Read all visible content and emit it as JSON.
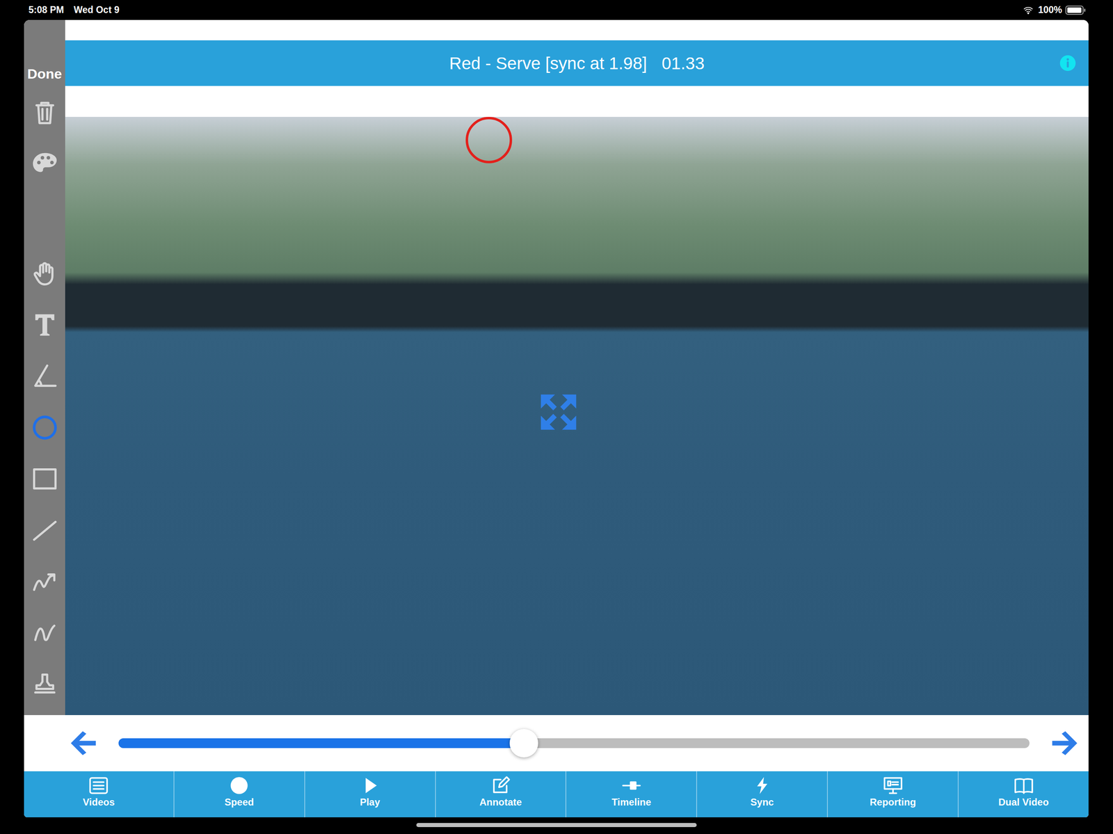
{
  "status_bar": {
    "time": "5:08 PM",
    "date": "Wed Oct 9",
    "battery": "100%",
    "battery_level": 1
  },
  "sidebar": {
    "done": "Done",
    "tools": [
      {
        "kind": "trash",
        "selected": false
      },
      {
        "kind": "palette",
        "selected": false
      },
      {
        "kind": "hand",
        "selected": false
      },
      {
        "kind": "text",
        "selected": false
      },
      {
        "kind": "angle",
        "selected": false
      },
      {
        "kind": "circle",
        "selected": true
      },
      {
        "kind": "rectangle",
        "selected": false
      },
      {
        "kind": "line",
        "selected": false
      },
      {
        "kind": "arrow",
        "selected": false
      },
      {
        "kind": "freehand",
        "selected": false
      },
      {
        "kind": "stamp",
        "selected": false
      }
    ]
  },
  "header": {
    "title": "Red - Serve [sync at 1.98]",
    "time": "01.33"
  },
  "scrubber": {
    "level": 0.445
  },
  "toolbar": [
    {
      "label": "Videos",
      "kind": "videos"
    },
    {
      "label": "Speed",
      "kind": "speed"
    },
    {
      "label": "Play",
      "kind": "play"
    },
    {
      "label": "Annotate",
      "kind": "annotate"
    },
    {
      "label": "Timeline",
      "kind": "timeline"
    },
    {
      "label": "Sync",
      "kind": "sync"
    },
    {
      "label": "Reporting",
      "kind": "reporting"
    },
    {
      "label": "Dual Video",
      "kind": "dual"
    }
  ]
}
